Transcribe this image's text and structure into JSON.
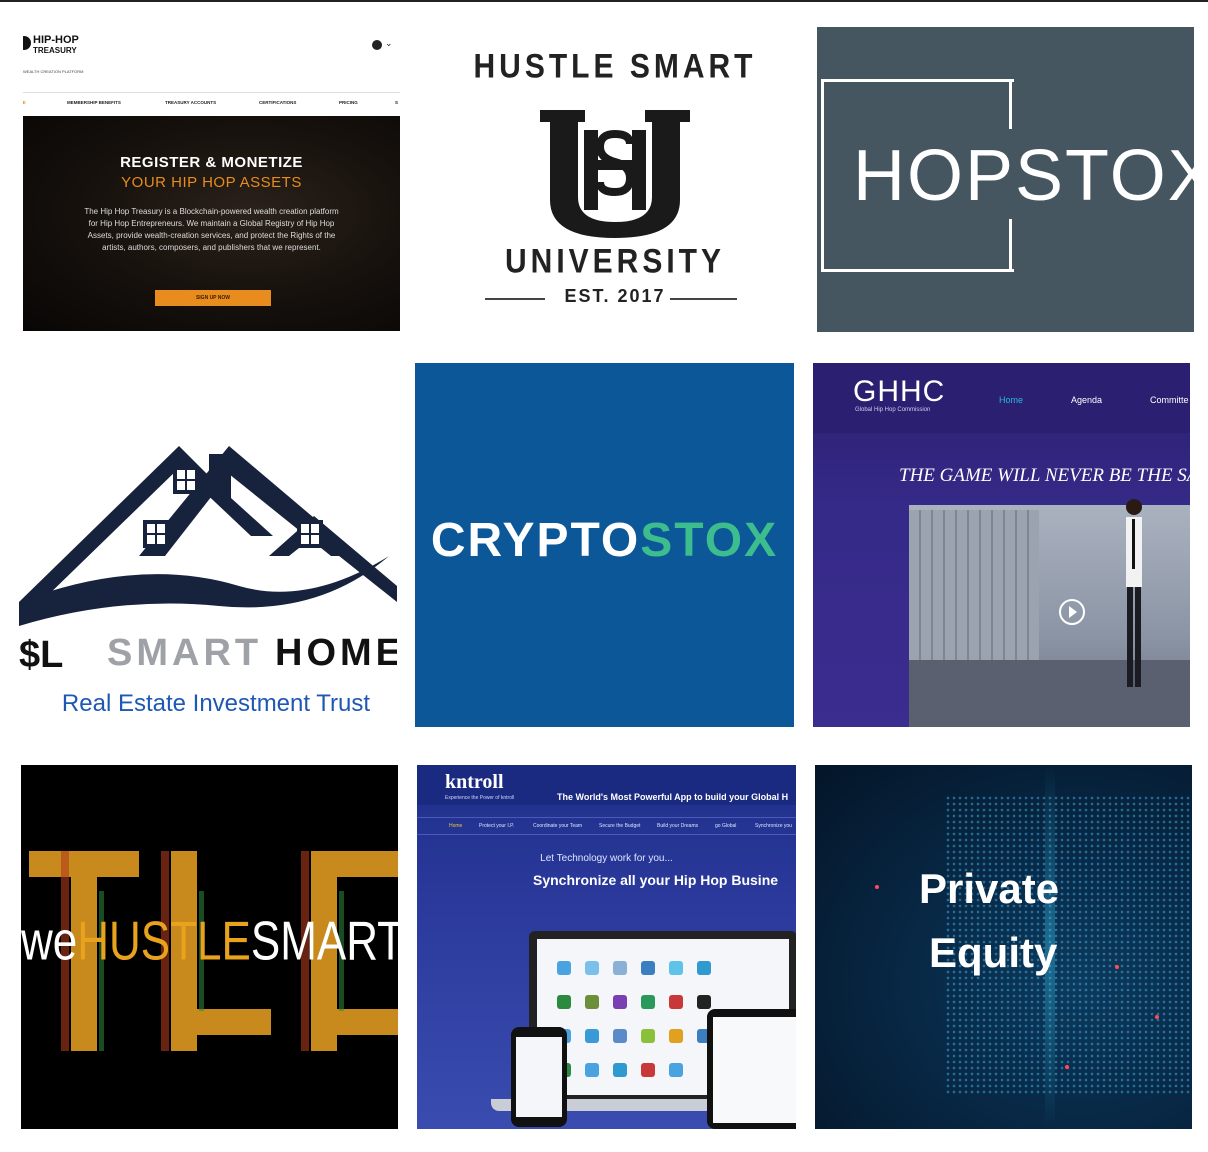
{
  "tiles": {
    "hiphop_treasury": {
      "logo_line1": "HIP-HOP",
      "logo_line2": "TREASURY",
      "tagline": "WEALTH CREATION PLATFORM",
      "nav": [
        "ME",
        "MEMBERSHIP BENEFITS",
        "TREASURY ACCOUNTS",
        "CERTIFICATIONS",
        "PRICING",
        "S"
      ],
      "headline1": "REGISTER & MONETIZE",
      "headline2": "YOUR HIP HOP ASSETS",
      "body": "The Hip Hop Treasury is a Blockchain-powered wealth creation platform for Hip Hop Entrepreneurs. We maintain a Global Registry of Hip Hop Assets, provide wealth-creation services, and protect the Rights of the artists, authors, composers, and publishers that we represent.",
      "cta": "SIGN UP NOW"
    },
    "hustle_smart_university": {
      "top": "HUSTLE SMART",
      "bottom": "UNIVERSITY",
      "est": "EST. 2017",
      "monogram": "HSU"
    },
    "hopstox": {
      "word": "HOPSTOX"
    },
    "smart_home": {
      "sl": "$L",
      "smart": "SMART",
      "home": "HOME",
      "caption": "Real Estate Investment Trust"
    },
    "cryptostox": {
      "part1": "CRYPTO",
      "part2": "STOX"
    },
    "ghhc": {
      "brand": "GHHC",
      "brand_sub": "Global Hip Hop Commission",
      "nav": [
        "Home",
        "Agenda",
        "Committe"
      ],
      "motto": "THE GAME WILL NEVER BE THE SA"
    },
    "wehustlesmart": {
      "we": "we",
      "hustle": "HUSTLE",
      "smart": "SMART"
    },
    "kntroll": {
      "logo": "kntroll",
      "logo_sub": "Experience the Power of kntroll",
      "tagline": "The World's Most Powerful App to build your Global H",
      "nav": [
        "Home",
        "Protect your I.P.",
        "Coordinate your Team",
        "Secure the Budget",
        "Build your Dreams",
        "go Global",
        "Synchronize you"
      ],
      "line1": "Let Technology work for you...",
      "line2": "Synchronize all your Hip Hop Busine"
    },
    "private_equity": {
      "line1": "Private",
      "line2": "Equity"
    }
  },
  "colors": {
    "treasury_orange": "#e88c1e",
    "hopstox_bg": "#455661",
    "crypto_bg": "#0b5797",
    "crypto_green": "#3dbd8e",
    "reit_blue": "#1e58b4",
    "ghhc_purple": "#2b1f72",
    "kntroll_blue": "#1f2f8a",
    "hustle_gold": "#e8a21e"
  }
}
